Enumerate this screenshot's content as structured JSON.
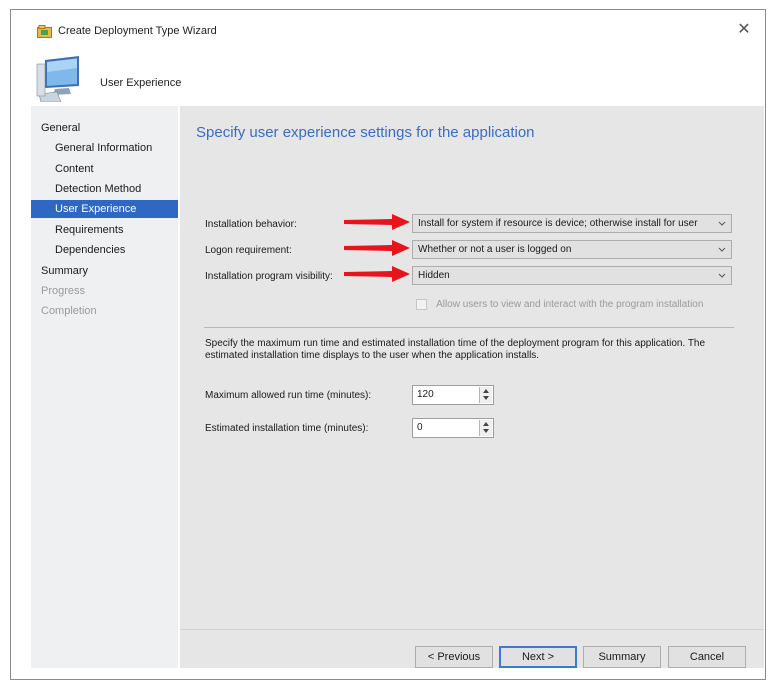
{
  "window": {
    "title": "Create Deployment Type Wizard",
    "close_glyph": "✕",
    "app_icon": "wizard-app-icon"
  },
  "header": {
    "title": "User Experience",
    "icon": "computer-monitor-icon"
  },
  "nav": {
    "items": [
      {
        "label": "General",
        "state": "normal",
        "level": 0
      },
      {
        "label": "General Information",
        "state": "normal",
        "level": 1
      },
      {
        "label": "Content",
        "state": "normal",
        "level": 1
      },
      {
        "label": "Detection Method",
        "state": "normal",
        "level": 1
      },
      {
        "label": "User Experience",
        "state": "active",
        "level": 1
      },
      {
        "label": "Requirements",
        "state": "normal",
        "level": 1
      },
      {
        "label": "Dependencies",
        "state": "normal",
        "level": 1
      },
      {
        "label": "Summary",
        "state": "normal",
        "level": 0
      },
      {
        "label": "Progress",
        "state": "disabled",
        "level": 0
      },
      {
        "label": "Completion",
        "state": "disabled",
        "level": 0
      }
    ]
  },
  "main": {
    "heading": "Specify user experience settings for the application",
    "installation_behavior": {
      "label": "Installation behavior:",
      "value": "Install for system if resource is device; otherwise install for user"
    },
    "logon_requirement": {
      "label": "Logon requirement:",
      "value": "Whether or not a user is logged on"
    },
    "program_visibility": {
      "label": "Installation program visibility:",
      "value": "Hidden"
    },
    "allow_interact": {
      "label": "Allow users to view and interact with the program installation",
      "checked": false,
      "enabled": false
    },
    "description": "Specify the maximum run time and estimated installation time of the deployment program for this application.  The estimated installation time displays to the user when the application installs.",
    "max_run_time": {
      "label": "Maximum allowed run time (minutes):",
      "value": "120"
    },
    "estimated_time": {
      "label": "Estimated installation time (minutes):",
      "value": "0"
    }
  },
  "buttons": {
    "previous": "< Previous",
    "next": "Next >",
    "summary": "Summary",
    "cancel": "Cancel"
  },
  "colors": {
    "accent": "#3b6bc4",
    "nav_selected": "#2e68c3",
    "annotation_arrow": "#e8141c"
  }
}
